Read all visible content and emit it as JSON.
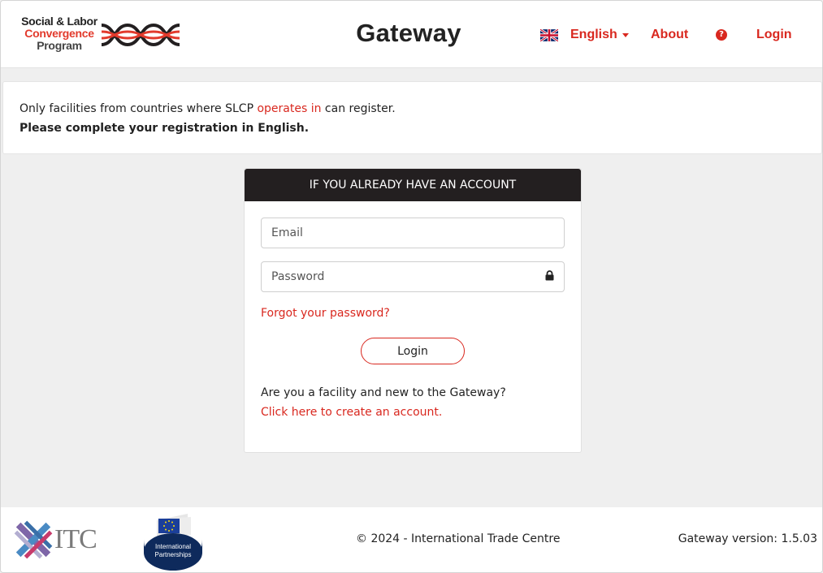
{
  "header": {
    "logo": {
      "line1": "Social & Labor",
      "line2": "Convergence",
      "line3": "Program"
    },
    "title": "Gateway",
    "nav": {
      "language": "English",
      "about": "About",
      "login": "Login"
    }
  },
  "notice": {
    "line1_before": "Only facilities from countries where SLCP ",
    "line1_link": "operates in",
    "line1_after": " can register.",
    "line2": "Please complete your registration in English."
  },
  "login_card": {
    "heading": "IF YOU ALREADY HAVE AN ACCOUNT",
    "email_placeholder": "Email",
    "email_value": "",
    "password_placeholder": "Password",
    "password_value": "",
    "forgot_link": "Forgot your password?",
    "login_button": "Login",
    "new_question": "Are you a facility and new to the Gateway?",
    "create_link": "Click here to create an account."
  },
  "footer": {
    "itc_logo": "ITC",
    "eu_logo": {
      "line1": "International",
      "line2": "Partnerships"
    },
    "copyright": "© 2024 - International Trade Centre",
    "version": "Gateway version: 1.5.03"
  },
  "colors": {
    "accent": "#d9281f",
    "card_header": "#231f20",
    "background": "#efefef",
    "eu_blue": "#0e2a5c"
  },
  "icons": [
    "uk-flag-icon",
    "caret-down-icon",
    "help-circle-icon",
    "lock-icon"
  ]
}
